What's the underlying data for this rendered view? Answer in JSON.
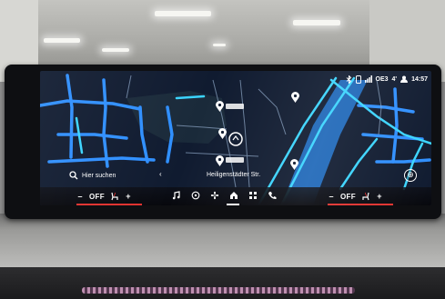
{
  "status_bar": {
    "signal_text": "OE3",
    "temperature": "4'",
    "time": "14:57"
  },
  "map": {
    "search_label": "Hier suchen",
    "street_name": "Heiligenstädter Str.",
    "zoom_symbol": "⊕"
  },
  "climate_left": {
    "minus": "–",
    "value": "OFF",
    "plus": "+"
  },
  "climate_right": {
    "minus": "–",
    "value": "OFF",
    "plus": "+"
  },
  "nav": {
    "items": [
      "music-icon",
      "connected-icon",
      "fan-icon",
      "home-icon",
      "apps-icon",
      "phone-icon"
    ],
    "active": "home-icon"
  },
  "colors": {
    "road_primary": "#2f8fff",
    "road_cyan": "#3ad4ff",
    "map_bg": "#101b30",
    "accent_red": "#e0312e"
  }
}
